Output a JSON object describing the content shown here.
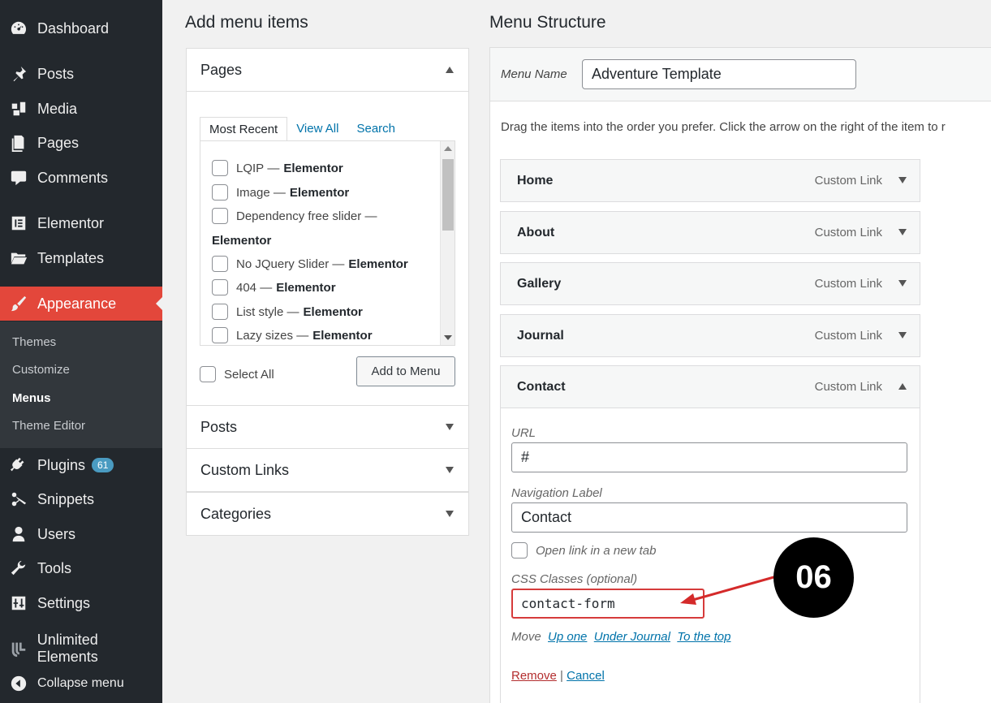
{
  "sidebar": {
    "items": [
      {
        "label": "Dashboard",
        "icon": "dashboard-icon"
      },
      {
        "label": "Posts",
        "icon": "pin-icon"
      },
      {
        "label": "Media",
        "icon": "media-icon"
      },
      {
        "label": "Pages",
        "icon": "pages-icon"
      },
      {
        "label": "Comments",
        "icon": "comment-icon"
      },
      {
        "label": "Elementor",
        "icon": "elementor-icon"
      },
      {
        "label": "Templates",
        "icon": "folder-icon"
      },
      {
        "label": "Appearance",
        "icon": "brush-icon"
      },
      {
        "label": "Plugins",
        "icon": "plug-icon",
        "badge": "61"
      },
      {
        "label": "Snippets",
        "icon": "scissors-icon"
      },
      {
        "label": "Users",
        "icon": "user-icon"
      },
      {
        "label": "Tools",
        "icon": "wrench-icon"
      },
      {
        "label": "Settings",
        "icon": "settings-icon"
      },
      {
        "label": "Unlimited Elements",
        "icon": "unlimited-icon"
      },
      {
        "label": "Collapse menu",
        "icon": "collapse-icon"
      }
    ],
    "submenu": [
      "Themes",
      "Customize",
      "Menus",
      "Theme Editor"
    ],
    "active_color": "#e3473b"
  },
  "add_items": {
    "title": "Add menu items",
    "pages_title": "Pages",
    "tabs": [
      "Most Recent",
      "View All",
      "Search"
    ],
    "pages": [
      {
        "name": "LQIP",
        "suffix": "Elementor"
      },
      {
        "name": "Image",
        "suffix": "Elementor"
      },
      {
        "name": "Dependency free slider",
        "suffix": "Elementor"
      },
      {
        "name": "No JQuery Slider",
        "suffix": "Elementor"
      },
      {
        "name": "404",
        "suffix": "Elementor"
      },
      {
        "name": "List style",
        "suffix": "Elementor"
      },
      {
        "name": "Lazy sizes",
        "suffix": "Elementor"
      }
    ],
    "dash": "—",
    "select_all": "Select All",
    "add_button": "Add to Menu",
    "sections": [
      "Posts",
      "Custom Links",
      "Categories"
    ]
  },
  "menu_structure": {
    "title": "Menu Structure",
    "name_label": "Menu Name",
    "name_value": "Adventure Template",
    "instructions": "Drag the items into the order you prefer. Click the arrow on the right of the item to r",
    "items": [
      {
        "label": "Home",
        "type": "Custom Link"
      },
      {
        "label": "About",
        "type": "Custom Link"
      },
      {
        "label": "Gallery",
        "type": "Custom Link"
      },
      {
        "label": "Journal",
        "type": "Custom Link"
      },
      {
        "label": "Contact",
        "type": "Custom Link"
      }
    ],
    "expanded": {
      "url_label": "URL",
      "url_value": "#",
      "nav_label_label": "Navigation Label",
      "nav_label_value": "Contact",
      "new_tab_label": "Open link in a new tab",
      "css_label": "CSS Classes (optional)",
      "css_value": "contact-form",
      "move_label": "Move",
      "move_links": [
        "Up one",
        "Under Journal",
        "To the top"
      ],
      "remove": "Remove",
      "separator": "|",
      "cancel": "Cancel"
    }
  },
  "callout": {
    "label": "06",
    "arrow_color": "#d42a2a"
  }
}
